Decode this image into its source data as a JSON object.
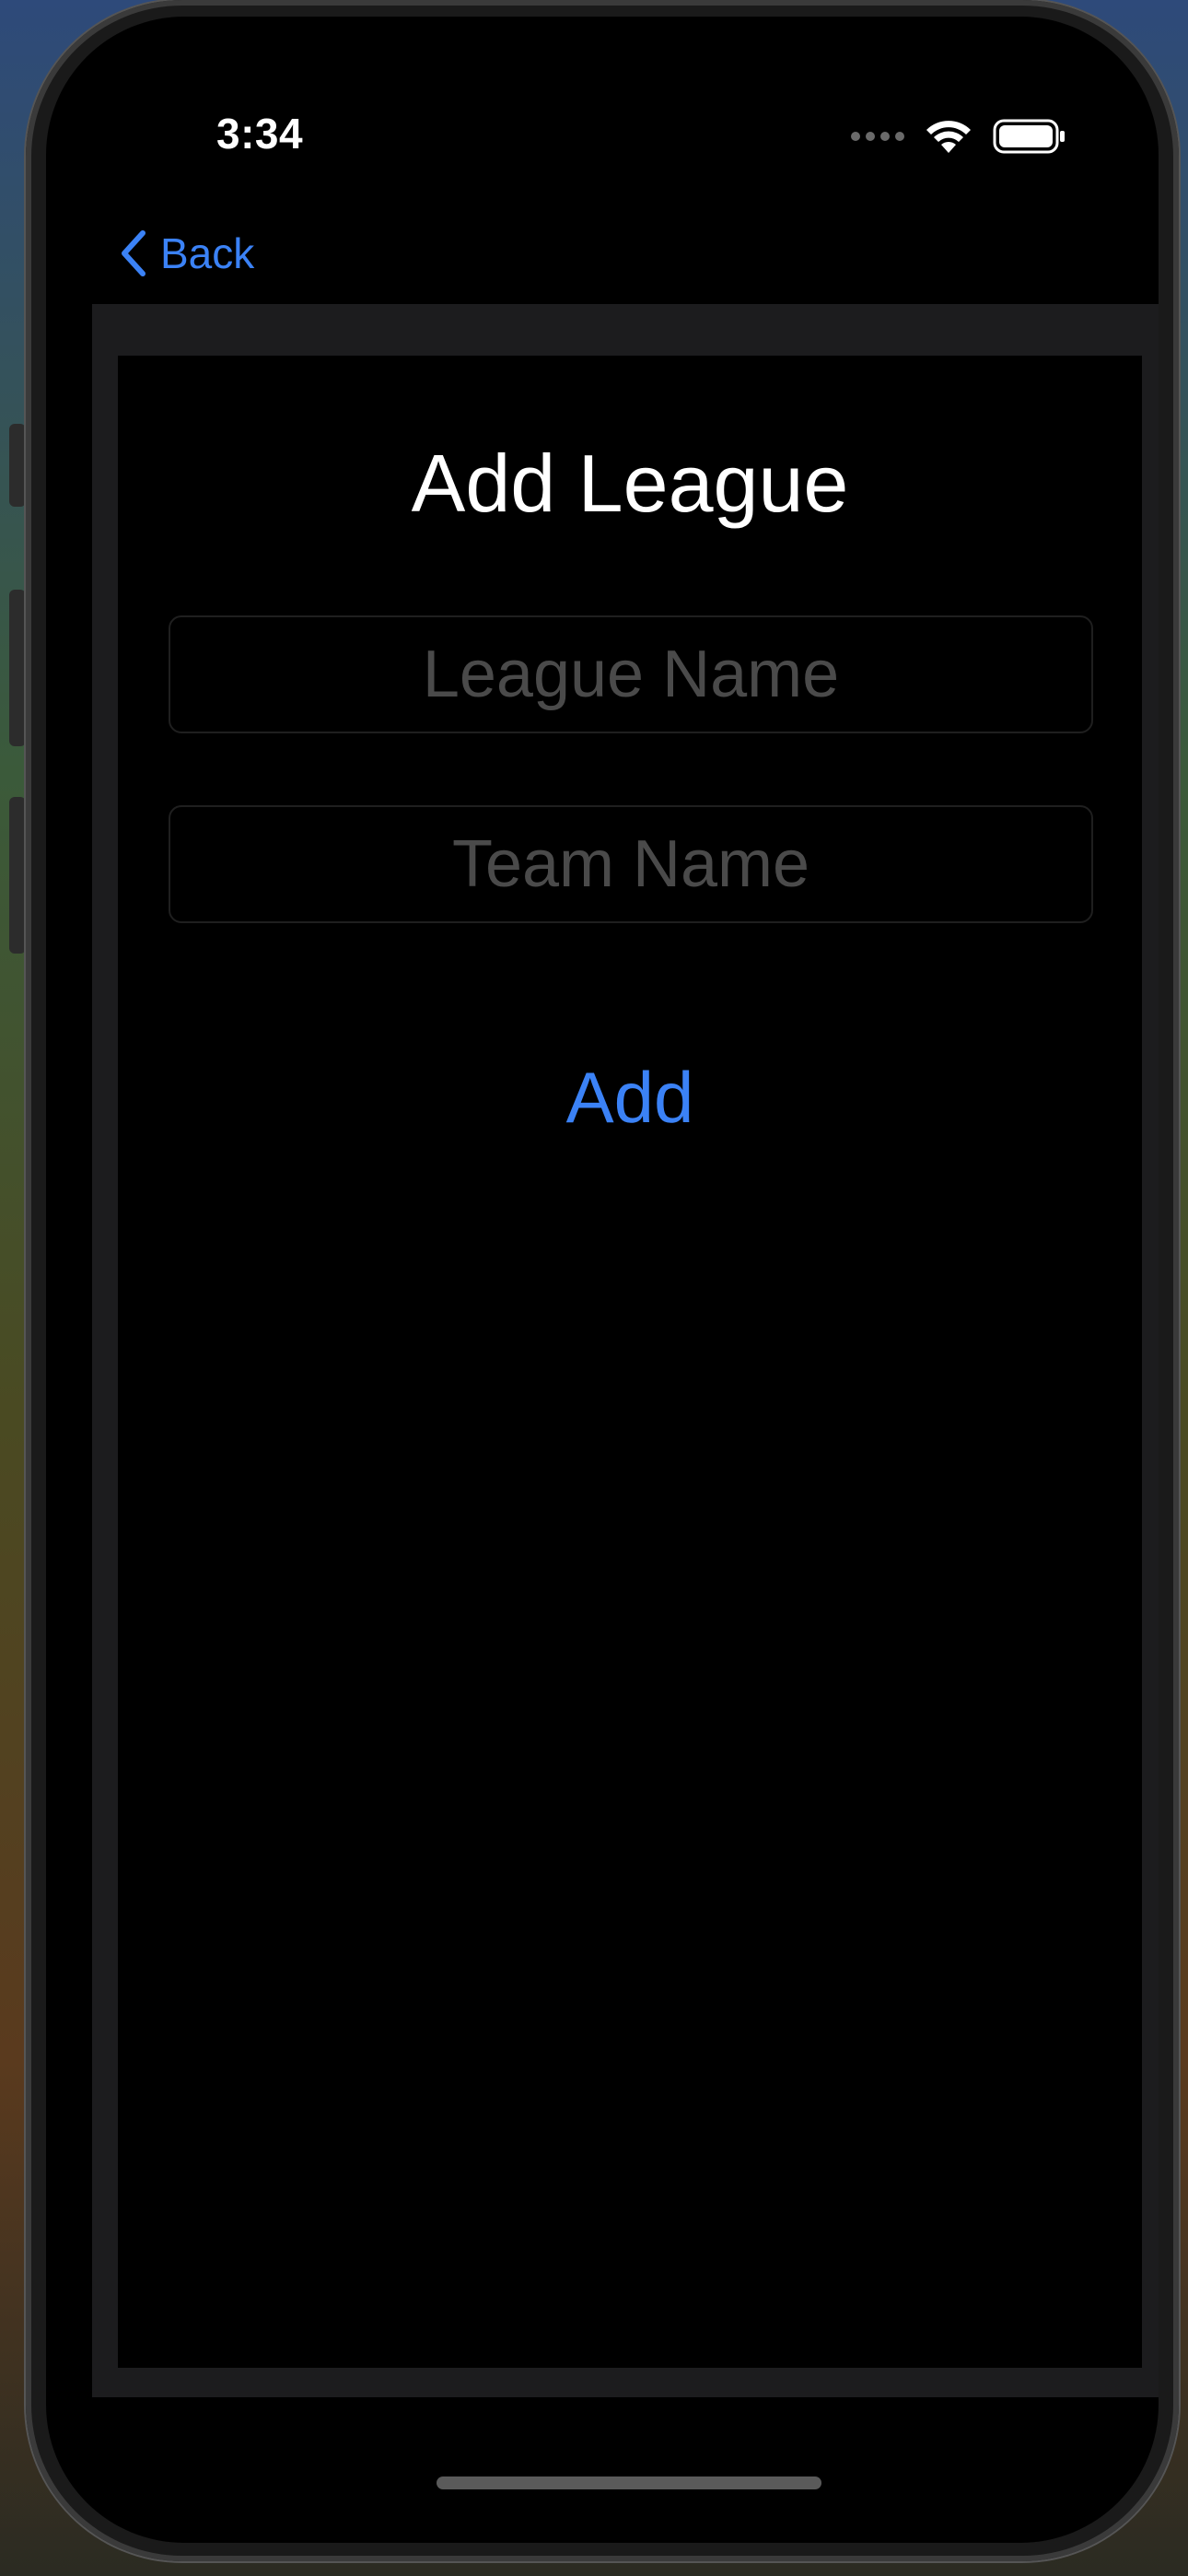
{
  "status_bar": {
    "time": "3:34"
  },
  "nav": {
    "back_label": "Back"
  },
  "form": {
    "title": "Add League",
    "league_name": {
      "value": "",
      "placeholder": "League Name"
    },
    "team_name": {
      "value": "",
      "placeholder": "Team Name"
    },
    "add_label": "Add"
  },
  "colors": {
    "accent": "#3b82f6",
    "background": "#000000",
    "panel": "#1c1c1e",
    "placeholder": "#4a4a4a"
  },
  "icons": {
    "back": "chevron-left-icon",
    "signal": "cellular-signal-icon",
    "wifi": "wifi-icon",
    "battery": "battery-icon"
  }
}
